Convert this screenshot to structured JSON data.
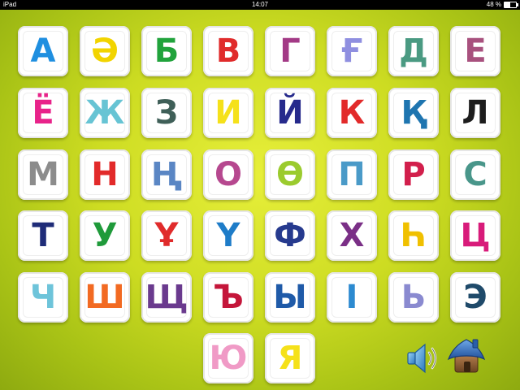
{
  "status_bar": {
    "device": "iPad",
    "time": "14:07",
    "battery": "48 %",
    "battery_level": 0.48
  },
  "letters": [
    {
      "char": "А",
      "color": "#1f8fe0"
    },
    {
      "char": "Ә",
      "color": "#f2d400"
    },
    {
      "char": "Б",
      "color": "#21a33c"
    },
    {
      "char": "В",
      "color": "#e02b2b"
    },
    {
      "char": "Г",
      "color": "#a33a86"
    },
    {
      "char": "Ғ",
      "color": "#8f8fe0"
    },
    {
      "char": "Д",
      "color": "#4a9a82"
    },
    {
      "char": "Е",
      "color": "#a8517e"
    },
    {
      "char": "Ё",
      "color": "#e8238a"
    },
    {
      "char": "Ж",
      "color": "#67c4d4"
    },
    {
      "char": "З",
      "color": "#3f5f58"
    },
    {
      "char": "И",
      "color": "#f5e11a"
    },
    {
      "char": "Й",
      "color": "#262a8c"
    },
    {
      "char": "К",
      "color": "#e22a2a"
    },
    {
      "char": "Қ",
      "color": "#1e75b0"
    },
    {
      "char": "Л",
      "color": "#1d1d1d"
    },
    {
      "char": "М",
      "color": "#8c8c8c"
    },
    {
      "char": "Н",
      "color": "#e22a2a"
    },
    {
      "char": "Ң",
      "color": "#5a86c4"
    },
    {
      "char": "О",
      "color": "#b6488f"
    },
    {
      "char": "Ө",
      "color": "#9bcb2e"
    },
    {
      "char": "П",
      "color": "#4a9ac8"
    },
    {
      "char": "Р",
      "color": "#d21f4c"
    },
    {
      "char": "С",
      "color": "#49968a"
    },
    {
      "char": "Т",
      "color": "#1f2c78"
    },
    {
      "char": "У",
      "color": "#1f9a3a"
    },
    {
      "char": "Ұ",
      "color": "#e02b2b"
    },
    {
      "char": "Ү",
      "color": "#1e7cc8"
    },
    {
      "char": "Ф",
      "color": "#263a8e"
    },
    {
      "char": "Х",
      "color": "#7a2f86"
    },
    {
      "char": "Һ",
      "color": "#f0c000"
    },
    {
      "char": "Ц",
      "color": "#d81b7a"
    },
    {
      "char": "Ч",
      "color": "#6ec4da"
    },
    {
      "char": "Ш",
      "color": "#f26a22"
    },
    {
      "char": "Щ",
      "color": "#6a3a8e"
    },
    {
      "char": "Ъ",
      "color": "#c4163a"
    },
    {
      "char": "Ы",
      "color": "#1f5aa8"
    },
    {
      "char": "І",
      "color": "#2c8ad0"
    },
    {
      "char": "Ь",
      "color": "#8a8ad0"
    },
    {
      "char": "Э",
      "color": "#1f4a6a"
    },
    {
      "char": "Ю",
      "color": "#f09ac6"
    },
    {
      "char": "Я",
      "color": "#f5e11a"
    }
  ],
  "controls": {
    "speaker_icon": "speaker-icon",
    "home_icon": "home-icon"
  }
}
